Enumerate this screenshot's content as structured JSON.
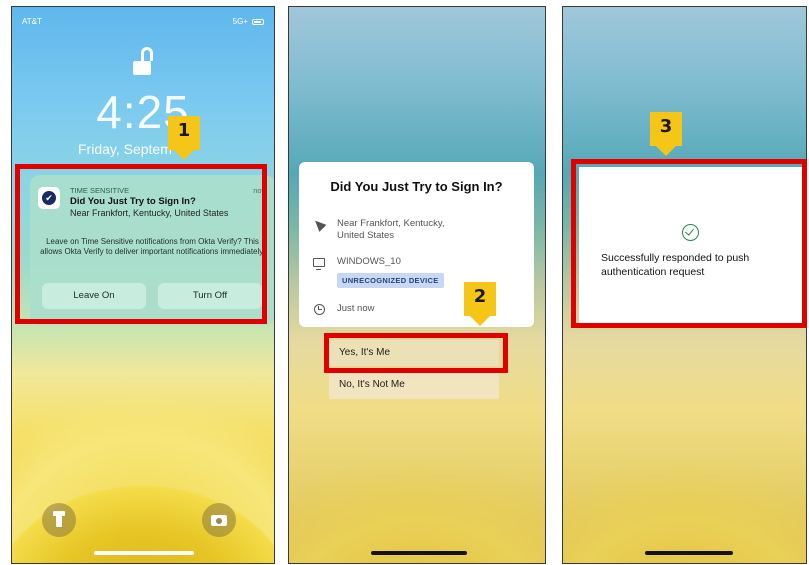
{
  "phone1": {
    "carrier": "AT&T",
    "status_right": "5G+",
    "time": "4:25",
    "date": "Friday, Septem",
    "notification": {
      "app_tag": "TIME SENSITIVE",
      "timestamp": "now",
      "title": "Did You Just Try to Sign In?",
      "location": "Near Frankfort, Kentucky, United States",
      "body": "Leave on Time Sensitive notifications from Okta Verify? This allows Okta Verify to deliver important notifications immediately.",
      "leave_on_label": "Leave On",
      "turn_off_label": "Turn Off"
    }
  },
  "phone2": {
    "card": {
      "title": "Did You Just Try to Sign In?",
      "location": "Near Frankfort, Kentucky, United States",
      "device": "WINDOWS_10",
      "device_badge": "UNRECOGNIZED DEVICE",
      "time": "Just now"
    },
    "yes_label": "Yes, It's Me",
    "no_label": "No, It's Not Me"
  },
  "phone3": {
    "message": "Successfully responded to push authentication request"
  },
  "callouts": {
    "step1": "1",
    "step2": "2",
    "step3": "3"
  },
  "colors": {
    "callout": "#f5c518",
    "highlight": "#e00000",
    "success": "#1f8a4c",
    "badge_bg": "#c7d8f5"
  }
}
